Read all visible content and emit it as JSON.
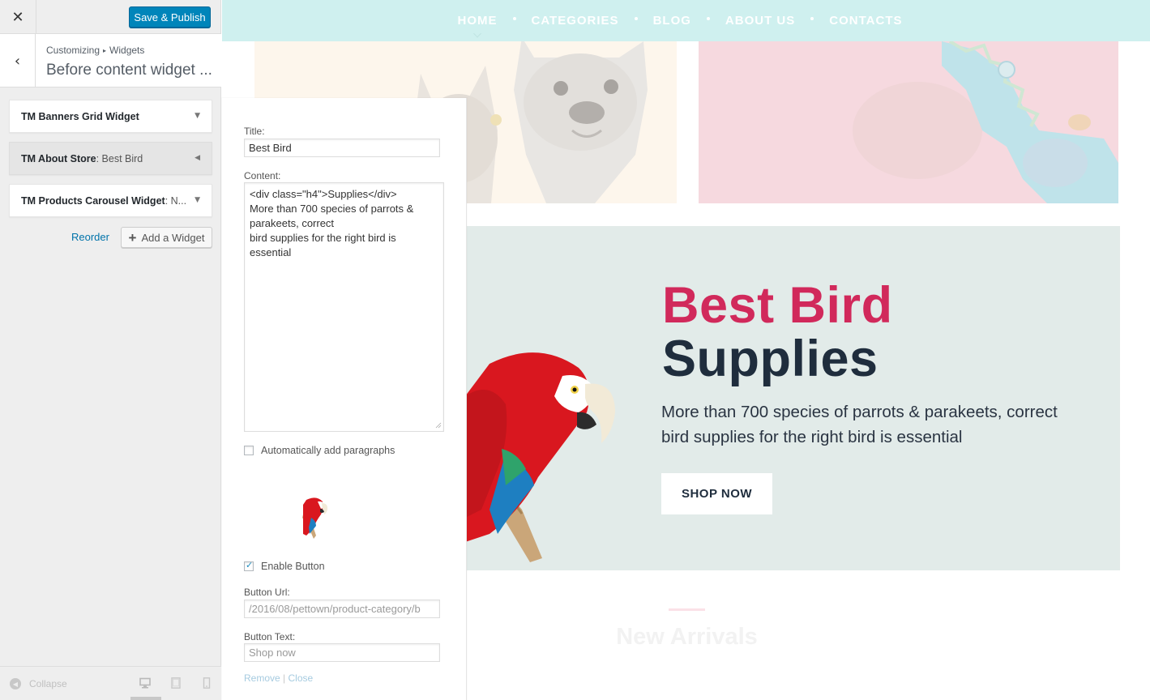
{
  "header": {
    "close_icon": "close-icon",
    "save_label": "Save & Publish"
  },
  "section": {
    "breadcrumb_root": "Customizing",
    "breadcrumb_child": "Widgets",
    "title": "Before content widget ..."
  },
  "widgets": [
    {
      "name": "TM Banners Grid Widget",
      "sub": "",
      "state": "collapsed"
    },
    {
      "name": "TM About Store",
      "sub": ": Best Bird",
      "state": "expanded"
    },
    {
      "name": "TM Products Carousel Widget",
      "sub": ": N...",
      "state": "collapsed"
    }
  ],
  "actions": {
    "reorder_label": "Reorder",
    "add_widget_label": "Add a Widget"
  },
  "footer": {
    "collapse_label": "Collapse",
    "devices": [
      "desktop",
      "tablet",
      "mobile"
    ],
    "active_device": "desktop"
  },
  "nav": {
    "items": [
      "HOME",
      "CATEGORIES",
      "BLOG",
      "ABOUT US",
      "CONTACTS"
    ],
    "current": "HOME"
  },
  "promo": {
    "title_line1": "Best Bird",
    "title_line2": "Supplies",
    "text": "More than 700 species of parrots & parakeets, correct bird supplies for the right bird is essential",
    "button_label": "SHOP NOW"
  },
  "new_arrivals": "New Arrivals",
  "form": {
    "title_label": "Title:",
    "title_value": "Best Bird",
    "content_label": "Content:",
    "content_value": "<div class=\"h4\">Supplies</div>\nMore than 700 species of parrots &\nparakeets, correct\nbird supplies for the right bird is\nessential",
    "auto_paragraphs_label": "Automatically add paragraphs",
    "auto_paragraphs_checked": false,
    "enable_button_label": "Enable Button",
    "enable_button_checked": true,
    "button_url_label": "Button Url:",
    "button_url_value": "/2016/08/pettown/product-category/b",
    "button_text_label": "Button Text:",
    "button_text_value": "Shop now",
    "remove_label": "Remove",
    "separator": "|",
    "close_label": "Close"
  },
  "colors": {
    "accent": "#0085ba",
    "promo_title_pink": "#d1295b",
    "promo_title_dark": "#1f2d3d",
    "nav_bg": "#cff0ef"
  }
}
